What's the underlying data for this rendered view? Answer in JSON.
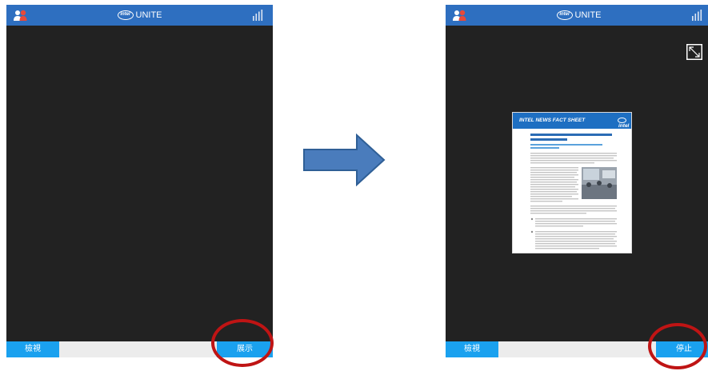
{
  "left_screen": {
    "brand": "UNITE",
    "brand_logo": "intel",
    "view_button": "檢視",
    "action_button": "展示"
  },
  "right_screen": {
    "brand": "UNITE",
    "brand_logo": "intel",
    "view_button": "檢視",
    "action_button": "停止",
    "shared_document": {
      "header": "INTEL NEWS FACT SHEET",
      "header_logo": "intel"
    }
  },
  "icons": {
    "users": "users-icon",
    "signal": "signal-bars-icon",
    "expand": "expand-icon",
    "arrow": "right-arrow-icon"
  },
  "colors": {
    "top_bar": "#2e6fc0",
    "screen_background": "#222222",
    "button": "#1aa1ef",
    "highlight_circle": "#bf1414",
    "arrow": "#4a7cbc"
  }
}
